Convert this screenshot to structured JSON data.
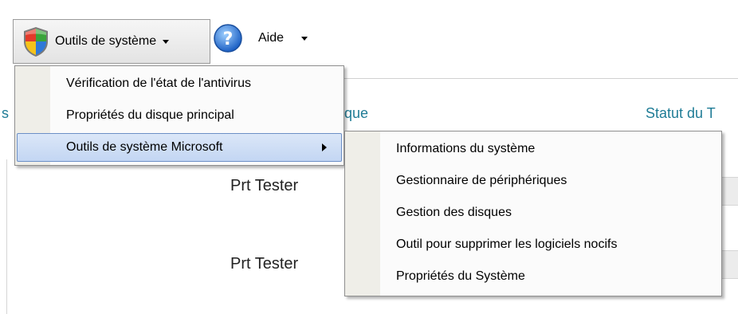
{
  "toolbar": {
    "tools_menu": {
      "label": "Outils de système",
      "icon": "windows-security-shield-icon"
    },
    "help_menu": {
      "label": "Aide",
      "icon": "help-question-icon"
    }
  },
  "background": {
    "columns": {
      "left_fragment": "s",
      "middle_fragment": "que",
      "right": "Statut du T"
    },
    "rows": [
      {
        "label": "Prt  Tester"
      },
      {
        "label": "Prt  Tester"
      }
    ]
  },
  "menu": {
    "items": [
      {
        "label": "Vérification de l'état de l'antivirus"
      },
      {
        "label": "Propriétés du disque principal"
      },
      {
        "label": "Outils de système Microsoft",
        "has_submenu": true,
        "highlighted": true
      }
    ]
  },
  "submenu": {
    "items": [
      {
        "label": "Informations du système"
      },
      {
        "label": "Gestionnaire de périphériques"
      },
      {
        "label": "Gestion des disques"
      },
      {
        "label": "Outil pour supprimer les logiciels nocifs"
      },
      {
        "label": "Propriétés du Système"
      }
    ]
  },
  "colors": {
    "accent_text": "#1f7c96",
    "highlight": "#c3d6f3",
    "highlight_border": "#6c8fc6"
  }
}
